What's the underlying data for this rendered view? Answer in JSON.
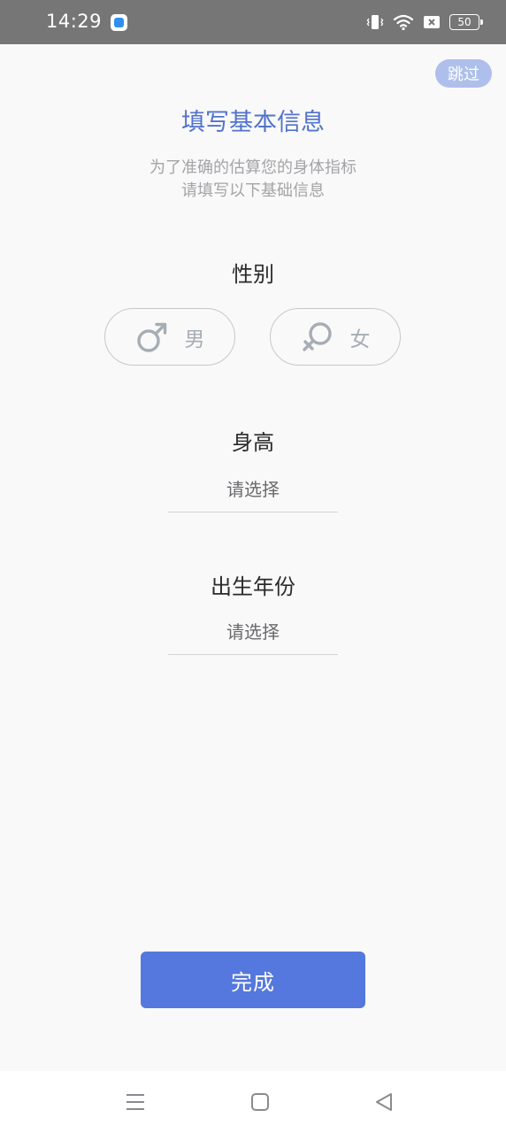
{
  "status_bar": {
    "time": "14:29",
    "battery": "50"
  },
  "skip_label": "跳过",
  "title": "填写基本信息",
  "subtitle_line1": "为了准确的估算您的身体指标",
  "subtitle_line2": "请填写以下基础信息",
  "gender": {
    "label": "性别",
    "male": "男",
    "female": "女"
  },
  "height": {
    "label": "身高",
    "value": "请选择"
  },
  "birth_year": {
    "label": "出生年份",
    "value": "请选择"
  },
  "done_label": "完成",
  "colors": {
    "accent": "#5478dd",
    "title": "#5273cd",
    "skip_bg": "#aebfeb",
    "status_bar": "#767676"
  },
  "icons": {
    "male": "male-symbol-icon",
    "female": "female-symbol-icon",
    "nav_menu": "menu-lines-icon",
    "nav_home": "square-home-icon",
    "nav_back": "triangle-back-icon"
  }
}
